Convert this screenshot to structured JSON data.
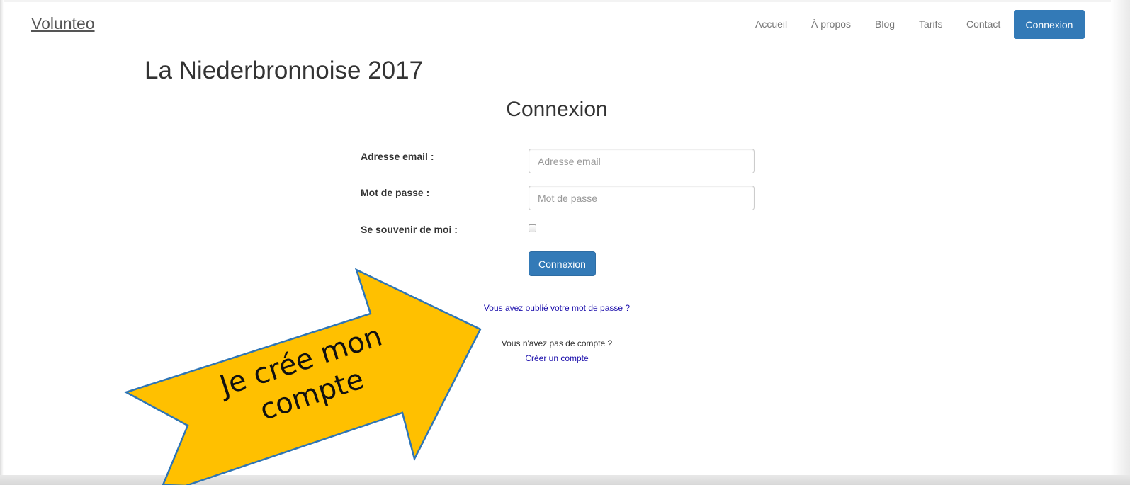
{
  "brand": "Volunteo",
  "nav": {
    "items": [
      "Accueil",
      "À propos",
      "Blog",
      "Tarifs",
      "Contact"
    ],
    "login_button": "Connexion"
  },
  "event_title": "La Niederbronnoise 2017",
  "form": {
    "heading": "Connexion",
    "email_label": "Adresse email :",
    "email_placeholder": "Adresse email",
    "password_label": "Mot de passe :",
    "password_placeholder": "Mot de passe",
    "remember_label": "Se souvenir de moi :",
    "submit_label": "Connexion"
  },
  "links": {
    "forgot_password": "Vous avez oublié votre mot de passe ?",
    "no_account": "Vous n'avez pas de compte ?",
    "create_account": "Créer un compte"
  },
  "callout": {
    "line1": "Je crée mon",
    "line2": "compte",
    "fill_color": "#ffc000",
    "stroke_color": "#2e75b6"
  },
  "colors": {
    "primary": "#337ab7",
    "link": "#1a0dab"
  }
}
